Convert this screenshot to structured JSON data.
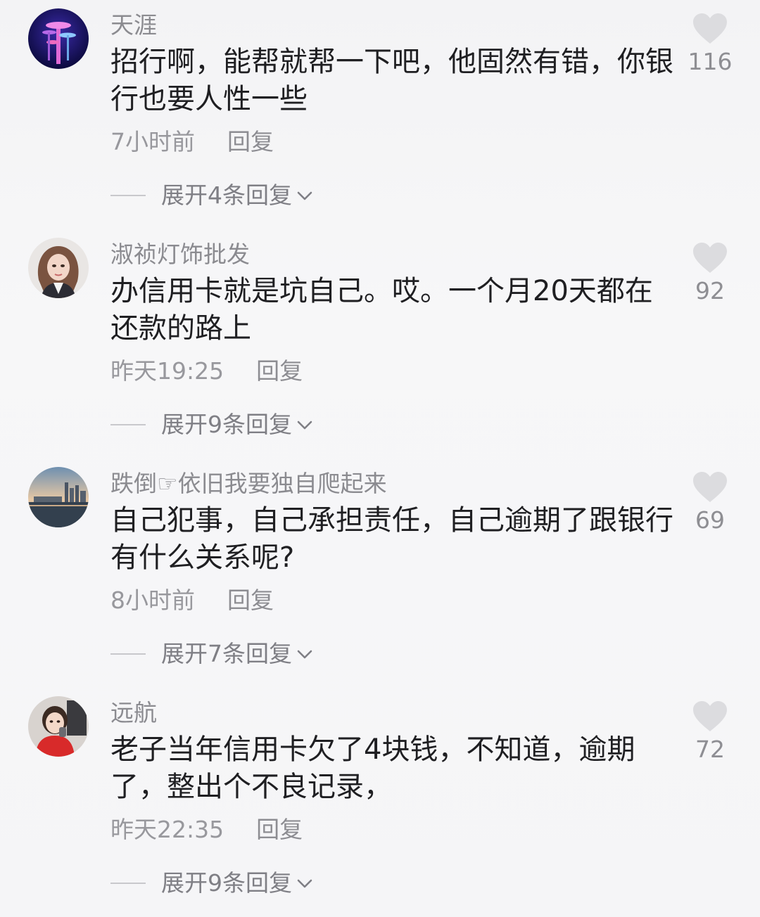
{
  "comments": [
    {
      "username": "天涯",
      "text": "招行啊，能帮就帮一下吧，他固然有错，你银\n行也要人性一些",
      "time": "7小时前",
      "reply_label": "回复",
      "expand_label": "展开4条回复",
      "likes": "116",
      "avatar_icon": "tower-night-avatar"
    },
    {
      "username": "淑祯灯饰批发",
      "text": "办信用卡就是坑自己。哎。一个月20天都在\n还款的路上",
      "time": "昨天19:25",
      "reply_label": "回复",
      "expand_label": "展开9条回复",
      "likes": "92",
      "avatar_icon": "woman-portrait-avatar"
    },
    {
      "username": "跌倒☞依旧我要独自爬起来",
      "text": "自己犯事，自己承担责任，自己逾期了跟银行\n有什么关系呢?",
      "time": "8小时前",
      "reply_label": "回复",
      "expand_label": "展开7条回复",
      "likes": "69",
      "avatar_icon": "city-skyline-avatar"
    },
    {
      "username": "远航",
      "text": "老子当年信用卡欠了4块钱，不知道，逾期\n了，整出个不良记录，",
      "time": "昨天22:35",
      "reply_label": "回复",
      "expand_label": "展开9条回复",
      "likes": "72",
      "avatar_icon": "girl-red-dress-avatar"
    }
  ],
  "colors": {
    "background": "#f5f5f7",
    "text": "#1f1f22",
    "secondary": "#8b8b90",
    "heart": "#dcdcdf"
  }
}
